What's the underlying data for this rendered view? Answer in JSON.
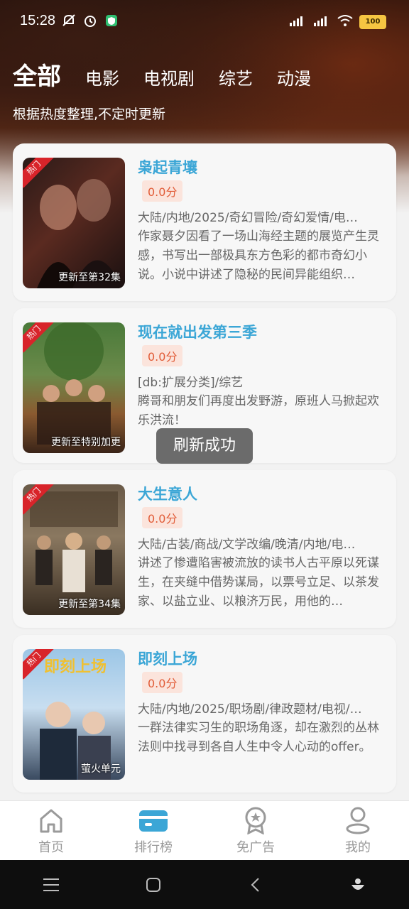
{
  "status": {
    "time": "15:28",
    "battery": "100"
  },
  "tabs": [
    {
      "label": "全部",
      "active": true
    },
    {
      "label": "电影",
      "active": false
    },
    {
      "label": "电视剧",
      "active": false
    },
    {
      "label": "综艺",
      "active": false
    },
    {
      "label": "动漫",
      "active": false
    }
  ],
  "subtitle": "根据热度整理,不定时更新",
  "items": [
    {
      "badge": "热门",
      "title": "枭起青壤",
      "score": "0.0分",
      "meta": "大陆/内地/2025/奇幻冒险/奇幻爱情/电…",
      "desc": "作家聂夕因看了一场山海经主题的展览产生灵感，书写出一部极具东方色彩的都市奇幻小说。小说中讲述了隐秘的民间异能组织…",
      "update": "更新至第32集"
    },
    {
      "badge": "热门",
      "title": "现在就出发第三季",
      "score": "0.0分",
      "meta": "[db:扩展分类]/综艺",
      "desc": "腾哥和朋友们再度出发野游，原班人马掀起欢乐洪流！",
      "update": "更新至特别加更"
    },
    {
      "badge": "热门",
      "title": "大生意人",
      "score": "0.0分",
      "meta": "大陆/古装/商战/文学改编/晚清/内地/电…",
      "desc": "讲述了惨遭陷害被流放的读书人古平原以死谋生，在夹缝中借势谋局，以票号立足、以茶发家、以盐立业、以粮济万民，用他的…",
      "update": "更新至第34集"
    },
    {
      "badge": "热门",
      "title": "即刻上场",
      "score": "0.0分",
      "meta": "大陆/内地/2025/职场剧/律政题材/电视/…",
      "desc": "一群法律实习生的职场角逐，却在激烈的丛林法则中找寻到各自人生中令人心动的offer。",
      "update": "萤火单元"
    }
  ],
  "toast": "刷新成功",
  "nav": [
    {
      "label": "首页",
      "icon": "home-icon"
    },
    {
      "label": "排行榜",
      "icon": "ranking-card-icon",
      "active": true
    },
    {
      "label": "免广告",
      "icon": "medal-icon"
    },
    {
      "label": "我的",
      "icon": "profile-icon"
    }
  ],
  "colors": {
    "accent": "#3ba6d6",
    "score_bg": "#fbe4dc",
    "score_text": "#e15c38",
    "badge": "#d8242a"
  }
}
